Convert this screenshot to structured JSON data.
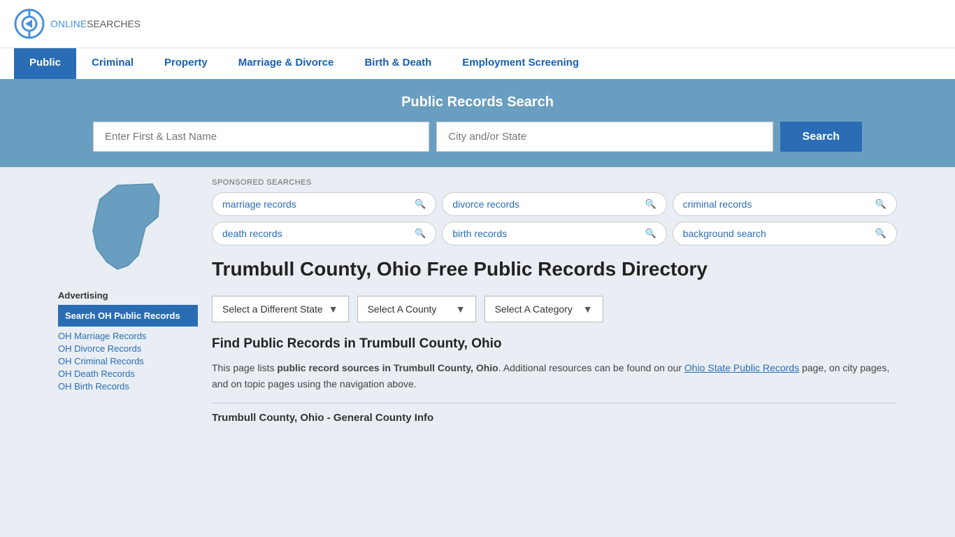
{
  "header": {
    "logo_online": "ONLINE",
    "logo_searches": "SEARCHES"
  },
  "nav": {
    "items": [
      {
        "label": "Public",
        "active": true
      },
      {
        "label": "Criminal",
        "active": false
      },
      {
        "label": "Property",
        "active": false
      },
      {
        "label": "Marriage & Divorce",
        "active": false
      },
      {
        "label": "Birth & Death",
        "active": false
      },
      {
        "label": "Employment Screening",
        "active": false
      }
    ]
  },
  "search_banner": {
    "title": "Public Records Search",
    "name_placeholder": "Enter First & Last Name",
    "location_placeholder": "City and/or State",
    "button_label": "Search"
  },
  "sponsored": {
    "label": "SPONSORED SEARCHES",
    "items": [
      "marriage records",
      "divorce records",
      "criminal records",
      "death records",
      "birth records",
      "background search"
    ]
  },
  "page_title": "Trumbull County, Ohio Free Public Records Directory",
  "dropdowns": {
    "state": "Select a Different State",
    "county": "Select A County",
    "category": "Select A Category"
  },
  "find_records": {
    "title": "Find Public Records in Trumbull County, Ohio",
    "text_before": "This page lists ",
    "text_bold": "public record sources in Trumbull County, Ohio",
    "text_after": ". Additional resources can be found on our ",
    "link_text": "Ohio State Public Records",
    "text_end": " page, on city pages, and on topic pages using the navigation above."
  },
  "general_info_title": "Trumbull County, Ohio - General County Info",
  "sidebar": {
    "advertising_title": "Advertising",
    "ad_highlight": "Search OH Public Records",
    "links": [
      "OH Marriage Records",
      "OH Divorce Records",
      "OH Criminal Records",
      "OH Death Records",
      "OH Birth Records"
    ]
  }
}
